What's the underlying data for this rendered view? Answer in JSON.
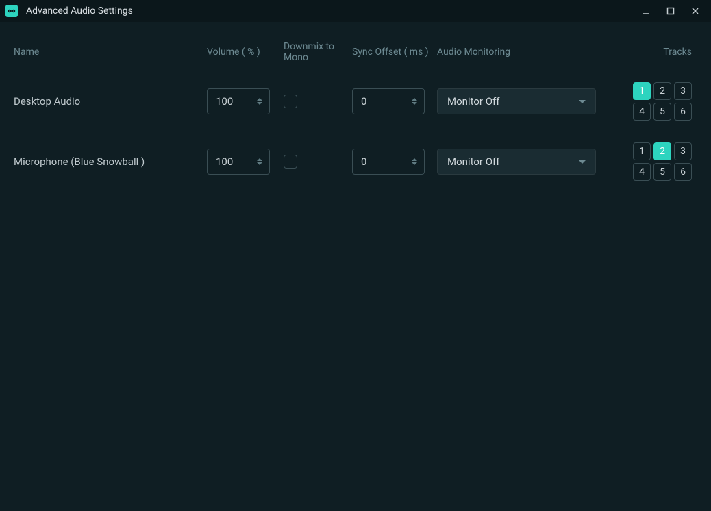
{
  "window": {
    "title": "Advanced Audio Settings"
  },
  "headers": {
    "name": "Name",
    "volume": "Volume ( % )",
    "downmix": "Downmix to Mono",
    "sync": "Sync Offset ( ms )",
    "monitoring": "Audio Monitoring",
    "tracks": "Tracks"
  },
  "rows": [
    {
      "name": "Desktop Audio",
      "volume": "100",
      "downmix": false,
      "sync": "0",
      "monitoring": "Monitor Off",
      "tracks": [
        true,
        false,
        false,
        false,
        false,
        false
      ]
    },
    {
      "name": "Microphone (Blue Snowball )",
      "volume": "100",
      "downmix": false,
      "sync": "0",
      "monitoring": "Monitor Off",
      "tracks": [
        false,
        true,
        false,
        false,
        false,
        false
      ]
    }
  ],
  "trackLabels": [
    "1",
    "2",
    "3",
    "4",
    "5",
    "6"
  ]
}
